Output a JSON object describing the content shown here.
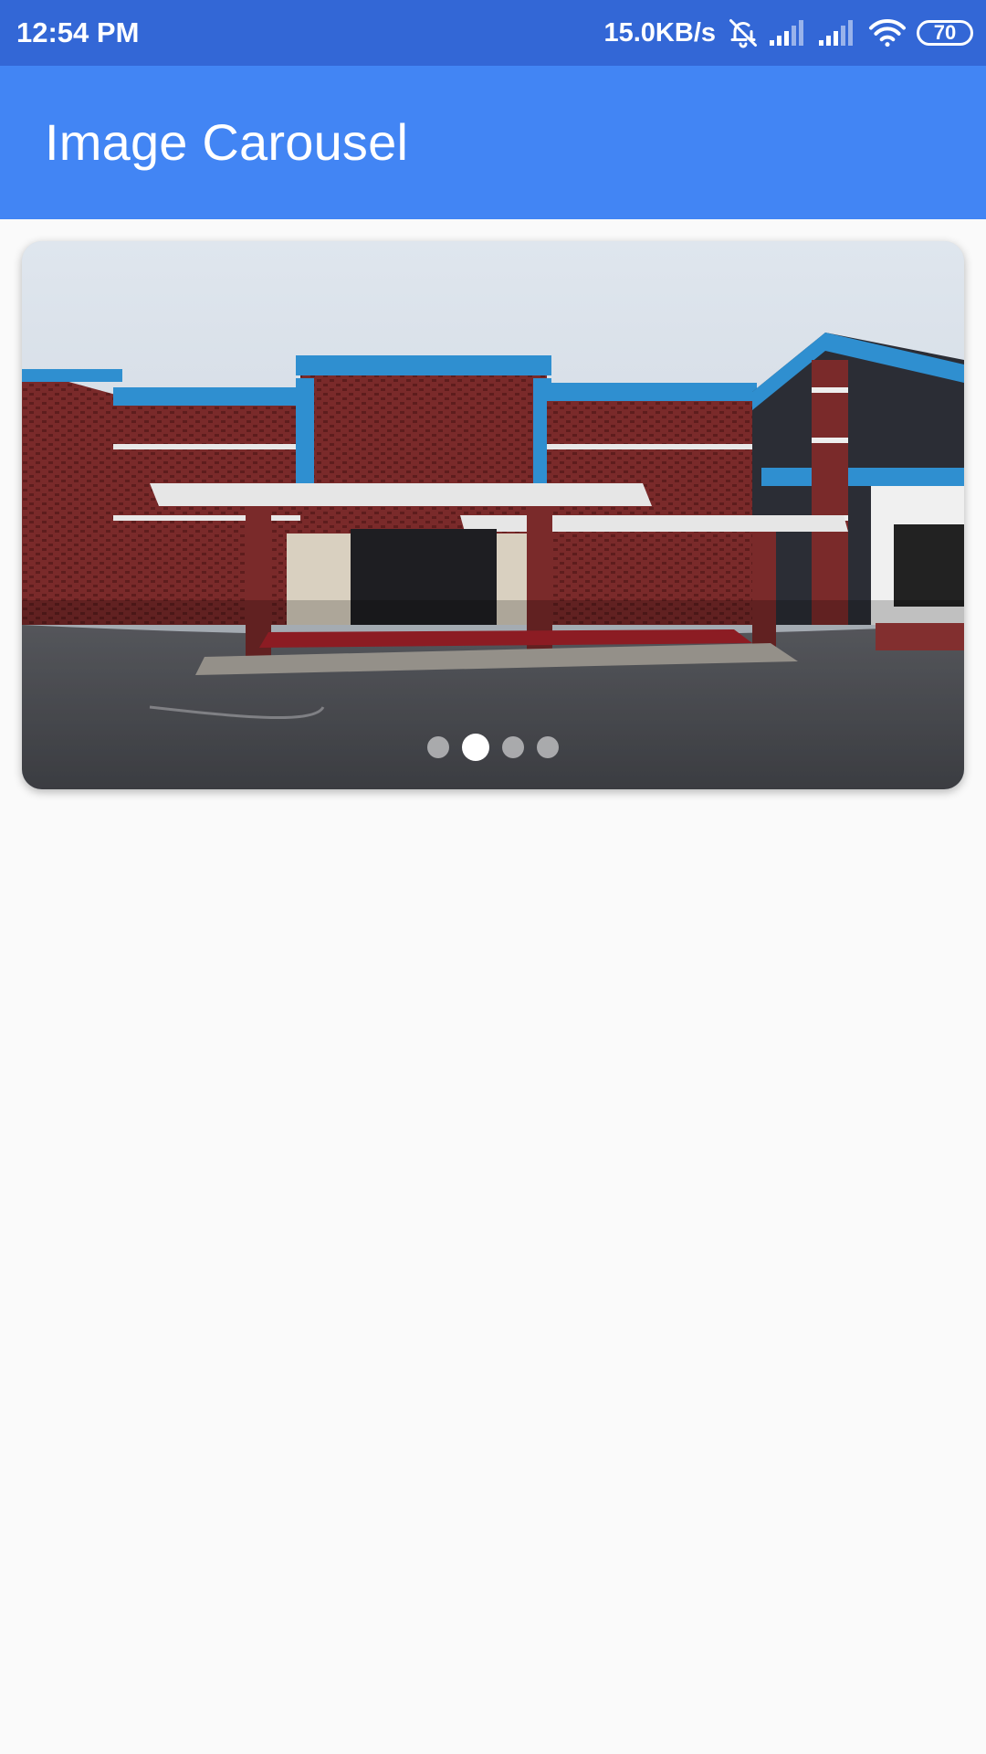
{
  "status_bar": {
    "time": "12:54 PM",
    "net_speed": "15.0KB/s",
    "icons": [
      "bell-off-icon",
      "signal-icon",
      "signal-icon",
      "wifi-icon",
      "battery-icon"
    ],
    "battery_level": "70"
  },
  "app_bar": {
    "title": "Image Carousel",
    "color": "#4285f4"
  },
  "carousel": {
    "slide_count": 4,
    "active_index": 1,
    "image_subject": "building"
  }
}
